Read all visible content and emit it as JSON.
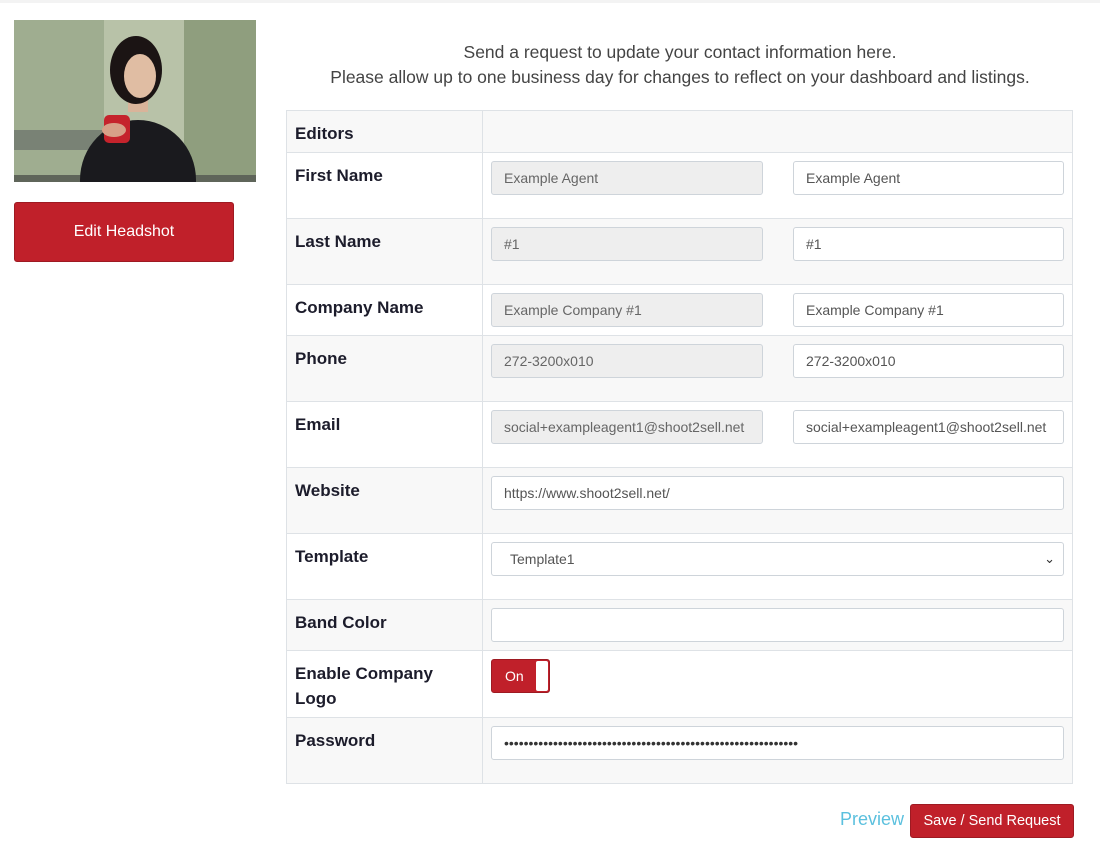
{
  "headshot": {
    "alt": "Agent headshot",
    "edit_label": "Edit Headshot"
  },
  "intro": {
    "line1": "Send a request to update your contact information here.",
    "line2": "Please allow up to one business day for changes to reflect on your dashboard and listings."
  },
  "form": {
    "editors_label": "Editors",
    "first_name": {
      "label": "First Name",
      "current": "Example Agent",
      "new": "Example Agent"
    },
    "last_name": {
      "label": "Last Name",
      "current": "#1",
      "new": "#1"
    },
    "company_name": {
      "label": "Company Name",
      "current": "Example Company #1",
      "new": "Example Company #1"
    },
    "phone": {
      "label": "Phone",
      "current": "272-3200x010",
      "new": "272-3200x010"
    },
    "email": {
      "label": "Email",
      "current": "social+exampleagent1@shoot2sell.net",
      "new": "social+exampleagent1@shoot2sell.net"
    },
    "website": {
      "label": "Website",
      "value": "https://www.shoot2sell.net/"
    },
    "template": {
      "label": "Template",
      "selected": "Template1"
    },
    "band_color": {
      "label": "Band Color",
      "value": ""
    },
    "company_logo": {
      "label": "Enable Company Logo",
      "toggle_text": "On",
      "enabled": true
    },
    "password": {
      "label": "Password",
      "value": "••••••••••••••••••••••••••••••••••••••••••••••••••••••••••••"
    }
  },
  "actions": {
    "preview_label": "Preview",
    "save_label": "Save / Send Request"
  },
  "colors": {
    "accent": "#c0202a",
    "link": "#5bc0de"
  }
}
